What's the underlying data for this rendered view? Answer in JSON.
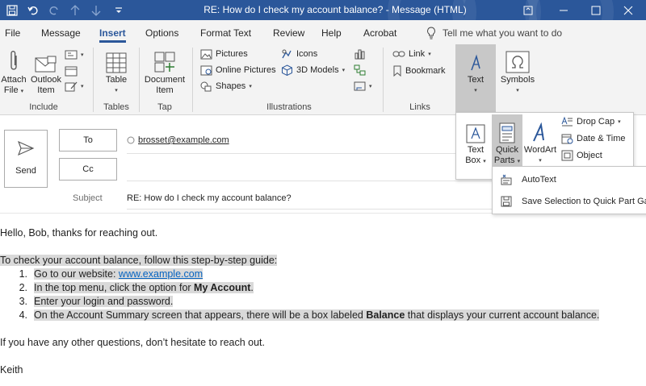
{
  "window": {
    "title": "RE: How do I check my account balance?  -  Message (HTML)"
  },
  "menu": {
    "tabs": [
      "File",
      "Message",
      "Insert",
      "Options",
      "Format Text",
      "Review",
      "Help",
      "Acrobat"
    ],
    "active": "Insert",
    "tell_me": "Tell me what you want to do"
  },
  "ribbon": {
    "include": {
      "label": "Include",
      "attach_file": [
        "Attach",
        "File"
      ],
      "outlook_item": [
        "Outlook",
        "Item"
      ]
    },
    "tables": {
      "label": "Tables",
      "table": "Table"
    },
    "tap": {
      "label": "Tap",
      "document_item": [
        "Document",
        "Item"
      ]
    },
    "illustrations": {
      "label": "Illustrations",
      "pictures": "Pictures",
      "online_pictures": "Online Pictures",
      "shapes": "Shapes",
      "icons": "Icons",
      "models_3d": "3D Models"
    },
    "links": {
      "label": "Links",
      "link": "Link",
      "bookmark": "Bookmark"
    },
    "text": "Text",
    "symbols": "Symbols"
  },
  "text_panel": {
    "text_box": [
      "Text",
      "Box"
    ],
    "quick_parts": [
      "Quick",
      "Parts"
    ],
    "wordart": "WordArt",
    "drop_cap": "Drop Cap",
    "date_time": "Date & Time",
    "object": "Object"
  },
  "quick_parts_menu": {
    "autotext": "AutoText",
    "save_selection": "Save Selection to Quick Part Gallery..."
  },
  "compose": {
    "send": "Send",
    "to_label": "To",
    "cc_label": "Cc",
    "subject_label": "Subject",
    "to_recipient": "brosset@example.com",
    "subject": "RE: How do I check my account balance?"
  },
  "body": {
    "greeting": "Hello, Bob, thanks for reaching out.",
    "intro": "To check your account balance, follow this step-by-step guide:",
    "steps": {
      "s1_prefix": "Go to our website: ",
      "s1_link": "www.example.com",
      "s2_prefix": "In the top menu, click the option for ",
      "s2_bold": "My Account",
      "s2_suffix": ".",
      "s3": "Enter your login and password.",
      "s4_prefix": "On the Account Summary screen that appears, there will be a box labeled ",
      "s4_bold": "Balance",
      "s4_suffix": " that displays your current account balance."
    },
    "numbers": [
      "1.",
      "2.",
      "3.",
      "4."
    ],
    "closing": "If you have any other questions, don’t hesitate to reach out.",
    "signature": "Keith"
  }
}
